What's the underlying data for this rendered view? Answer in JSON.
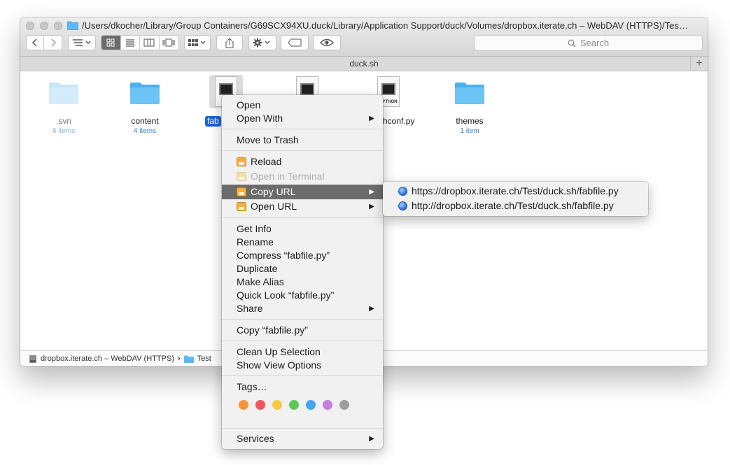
{
  "window": {
    "title": "/Users/dkocher/Library/Group Containers/G69SCX94XU.duck/Library/Application Support/duck/Volumes/dropbox.iterate.ch – WebDAV (HTTPS)/Tes…",
    "tab_title": "duck.sh",
    "tab_add": "+"
  },
  "toolbar": {
    "search_placeholder": "Search",
    "back_icon": "chevron-left-icon",
    "forward_icon": "chevron-right-icon",
    "view_modes": [
      "icon-view",
      "list-view",
      "column-view",
      "cover-flow-view"
    ],
    "active_view": "icon-view"
  },
  "files": [
    {
      "name": ".svn",
      "sub": "6 items",
      "kind": "folder",
      "faded": true
    },
    {
      "name": "content",
      "sub": "4 items",
      "kind": "folder"
    },
    {
      "name": "fabfile.py",
      "name_visible": "fab",
      "sub": "",
      "kind": "doc",
      "selected": true
    },
    {
      "name": "",
      "sub": "",
      "kind": "doc"
    },
    {
      "name": "…hconf.py",
      "name_visible": "hconf.py",
      "sub": "",
      "kind": "doc"
    },
    {
      "name": "themes",
      "sub": "1 item",
      "kind": "folder"
    }
  ],
  "statusbar": {
    "volume": "dropbox.iterate.ch – WebDAV (HTTPS)",
    "separator": "›",
    "folder": "Test"
  },
  "context_menu": {
    "open": "Open",
    "open_with": "Open With",
    "move_to_trash": "Move to Trash",
    "reload": "Reload",
    "open_in_terminal": "Open in Terminal",
    "copy_url": "Copy URL",
    "open_url": "Open URL",
    "get_info": "Get Info",
    "rename": "Rename",
    "compress": "Compress “fabfile.py”",
    "duplicate": "Duplicate",
    "make_alias": "Make Alias",
    "quick_look": "Quick Look “fabfile.py”",
    "share": "Share",
    "copy_file": "Copy “fabfile.py”",
    "clean_up": "Clean Up Selection",
    "show_view_options": "Show View Options",
    "tags": "Tags…",
    "services": "Services",
    "submenu_arrow": "▶"
  },
  "tag_colors": [
    "#f7943a",
    "#f2565a",
    "#f7c845",
    "#5cc85c",
    "#44a4f0",
    "#c57ee0",
    "#9e9e9e"
  ],
  "submenu": {
    "https_url": "https://dropbox.iterate.ch/Test/duck.sh/fabfile.py",
    "http_url": "http://dropbox.iterate.ch/Test/duck.sh/fabfile.py"
  },
  "colors": {
    "selection": "#1d63d4",
    "menu_highlight": "#6b6b6b",
    "folder": "#6cc4f4"
  }
}
